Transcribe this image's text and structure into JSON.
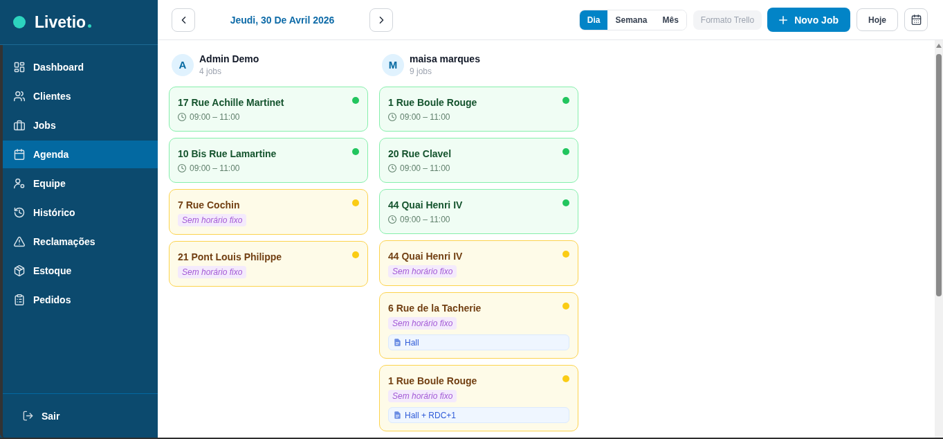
{
  "sidebar": {
    "logo": "Livetio",
    "items": [
      {
        "label": "Dashboard",
        "selected": false
      },
      {
        "label": "Clientes",
        "selected": false
      },
      {
        "label": "Jobs",
        "selected": false
      },
      {
        "label": "Agenda",
        "selected": true
      },
      {
        "label": "Equipe",
        "selected": false
      },
      {
        "label": "Histórico",
        "selected": false
      },
      {
        "label": "Reclamações",
        "selected": false
      },
      {
        "label": "Estoque",
        "selected": false
      },
      {
        "label": "Pedidos",
        "selected": false
      }
    ],
    "footer": {
      "label": "Sair"
    }
  },
  "header": {
    "date": "Jeudi, 30 De Avril 2026",
    "views": [
      {
        "label": "Dia",
        "selected": true
      },
      {
        "label": "Semana",
        "selected": false
      },
      {
        "label": "Mês",
        "selected": false
      }
    ],
    "trello": {
      "label": "Formato Trello",
      "on": false
    },
    "new_job": "Novo Job",
    "today": "Hoje"
  },
  "columns": [
    {
      "initial": "A",
      "name": "Admin Demo",
      "count": "4 jobs",
      "jobs": [
        {
          "kind": "timed",
          "title": "17 Rue Achille Martinet",
          "time": "09:00 – 11:00",
          "color": "#22c55e"
        },
        {
          "kind": "timed",
          "title": "10 Bis Rue Lamartine",
          "time": "09:00 – 11:00",
          "color": "#22c55e"
        },
        {
          "kind": "untimed",
          "title": "7 Rue Cochin",
          "tag": "Sem horário fixo",
          "color": "#facc15"
        },
        {
          "kind": "untimed",
          "title": "21 Pont Louis Philippe",
          "tag": "Sem horário fixo",
          "color": "#facc15"
        }
      ]
    },
    {
      "initial": "M",
      "name": "maisa marques",
      "count": "9 jobs",
      "jobs": [
        {
          "kind": "timed",
          "title": "1 Rue Boule Rouge",
          "time": "09:00 – 11:00",
          "color": "#22c55e"
        },
        {
          "kind": "timed",
          "title": "20 Rue Clavel",
          "time": "09:00 – 11:00",
          "color": "#22c55e"
        },
        {
          "kind": "timed",
          "title": "44 Quai Henri IV",
          "time": "09:00 – 11:00",
          "color": "#22c55e"
        },
        {
          "kind": "untimed",
          "title": "44 Quai Henri IV",
          "tag": "Sem horário fixo",
          "color": "#facc15"
        },
        {
          "kind": "untimed",
          "title": "6 Rue de la Tacherie",
          "tag": "Sem horário fixo",
          "note": "Hall",
          "color": "#facc15"
        },
        {
          "kind": "untimed",
          "title": "1 Rue Boule Rouge",
          "tag": "Sem horário fixo",
          "note": "Hall + RDC+1",
          "color": "#facc15"
        }
      ]
    }
  ]
}
